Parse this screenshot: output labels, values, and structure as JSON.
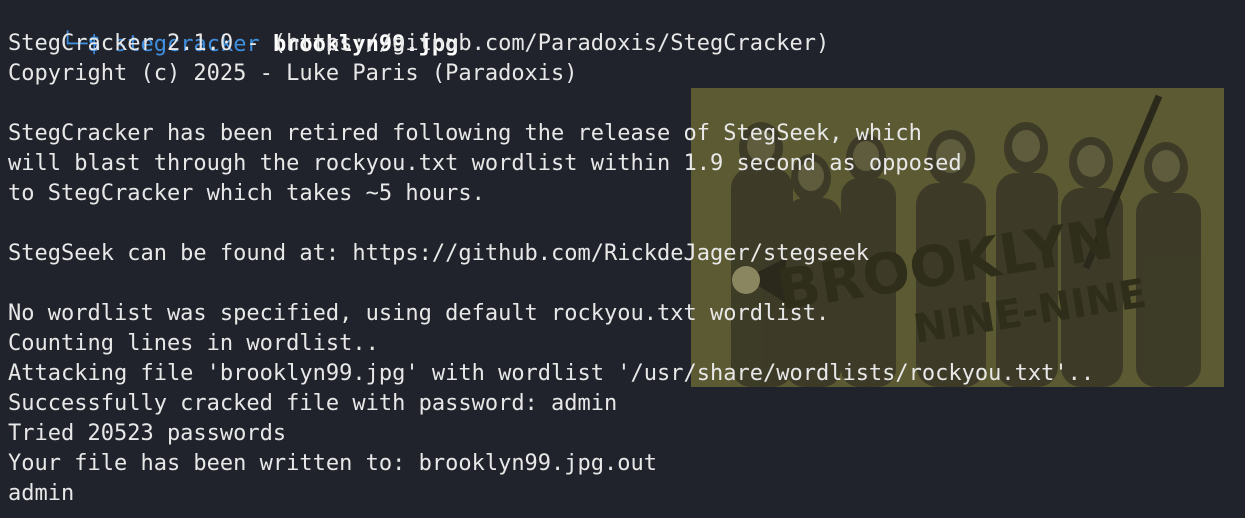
{
  "terminal": {
    "prompt": {
      "box": "└─",
      "dollar": "$",
      "command": "stegcracker",
      "argument": "brooklyn99.jpg"
    },
    "output": [
      "StegCracker 2.1.0 - (https://github.com/Paradoxis/StegCracker)",
      "Copyright (c) 2025 - Luke Paris (Paradoxis)",
      "",
      "StegCracker has been retired following the release of StegSeek, which",
      "will blast through the rockyou.txt wordlist within 1.9 second as opposed",
      "to StegCracker which takes ~5 hours.",
      "",
      "StegSeek can be found at: https://github.com/RickdeJager/stegseek",
      "",
      "No wordlist was specified, using default rockyou.txt wordlist.",
      "Counting lines in wordlist..",
      "Attacking file 'brooklyn99.jpg' with wordlist '/usr/share/wordlists/rockyou.txt'..",
      "Successfully cracked file with password: admin",
      "Tried 20523 passwords",
      "Your file has been written to: brooklyn99.jpg.out",
      "admin"
    ]
  },
  "poster": {
    "title_line1": "BROOKLYN",
    "title_line2": "NINE-NINE"
  },
  "colors": {
    "background": "#20232b",
    "text": "#e8e8e8",
    "prompt": "#3f8fe0",
    "poster": "#5c5a32"
  }
}
